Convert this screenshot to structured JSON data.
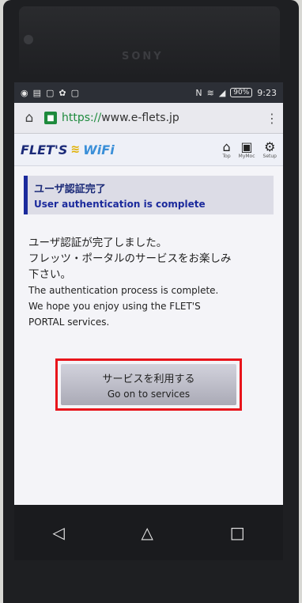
{
  "device": {
    "brand": "SONY"
  },
  "statusbar": {
    "time": "9:23",
    "battery": "90%",
    "left_icons": [
      "shield-icon",
      "image-icon",
      "notification-icon",
      "settings-icon",
      "notification-icon"
    ],
    "nfc": "N"
  },
  "browser": {
    "url_scheme": "https://",
    "url_host": "www.e-flets.jp",
    "home_glyph": "⌂",
    "lock_glyph": "🔒",
    "menu_glyph": "⋮"
  },
  "site": {
    "logo_flets": "FLET'S",
    "logo_wifi": "WiFi",
    "nav": [
      {
        "glyph": "⌂",
        "label": "Top"
      },
      {
        "glyph": "▣",
        "label": "MyMoc"
      },
      {
        "glyph": "⚙",
        "label": "Setup"
      }
    ]
  },
  "notice": {
    "title_jp": "ユーザ認証完了",
    "title_en": "User authentication is complete"
  },
  "message": {
    "jp_line1": "ユーザ認証が完了しました。",
    "jp_line2": "フレッツ・ポータルのサービスをお楽しみ",
    "jp_line3": "下さい。",
    "en_line1": "The authentication process is complete.",
    "en_line2": "We hope you enjoy using the FLET'S",
    "en_line3": "PORTAL services."
  },
  "cta": {
    "label_jp": "サービスを利用する",
    "label_en": "Go on to services"
  },
  "android_nav": {
    "back_glyph": "◁",
    "home_glyph": "△",
    "recents_glyph": "□"
  }
}
